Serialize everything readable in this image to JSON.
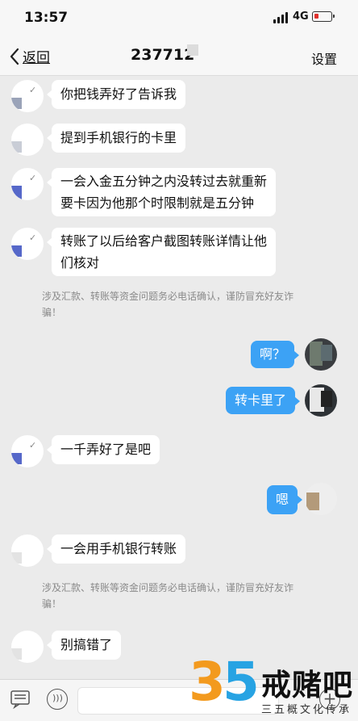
{
  "status_bar": {
    "time": "13:57",
    "network": "4G"
  },
  "nav": {
    "back_label": "返回",
    "title": "237712",
    "settings_label": "设置"
  },
  "messages": [
    {
      "side": "left",
      "lines": [
        "你把钱弄好了告诉我"
      ]
    },
    {
      "side": "left",
      "lines": [
        "提到手机银行的卡里"
      ]
    },
    {
      "side": "left",
      "lines": [
        "一会入金五分钟之内没转过去就重新",
        "要卡因为他那个时限制就是五分钟"
      ]
    },
    {
      "side": "left",
      "lines": [
        "转账了以后给客户截图转账详情让他",
        "们核对"
      ]
    },
    {
      "side": "notice",
      "lines": [
        "涉及汇款、转账等资金问题务必电话确认，谨防冒充好友诈",
        "骗！"
      ]
    },
    {
      "side": "right",
      "lines": [
        "啊？"
      ]
    },
    {
      "side": "right",
      "lines": [
        "转卡里了"
      ]
    },
    {
      "side": "left",
      "lines": [
        "一千弄好了是吧"
      ]
    },
    {
      "side": "right",
      "lines": [
        "嗯"
      ]
    },
    {
      "side": "left",
      "lines": [
        "一会用手机银行转账"
      ]
    },
    {
      "side": "notice",
      "lines": [
        "涉及汇款、转账等资金问题务必电话确认，谨防冒充好友诈",
        "骗！"
      ]
    },
    {
      "side": "left",
      "lines": [
        "别搞错了"
      ]
    }
  ],
  "watermark": {
    "number_a": "3",
    "number_b": "5",
    "name": "戒赌吧",
    "subtitle": "三五概文化传承"
  },
  "colors": {
    "my_bubble": "#3ca2f5",
    "their_bubble": "#ffffff",
    "background": "#ebebeb"
  },
  "icons": [
    "chevron-left-icon",
    "keyboard-icon",
    "voice-icon",
    "plus-icon"
  ]
}
